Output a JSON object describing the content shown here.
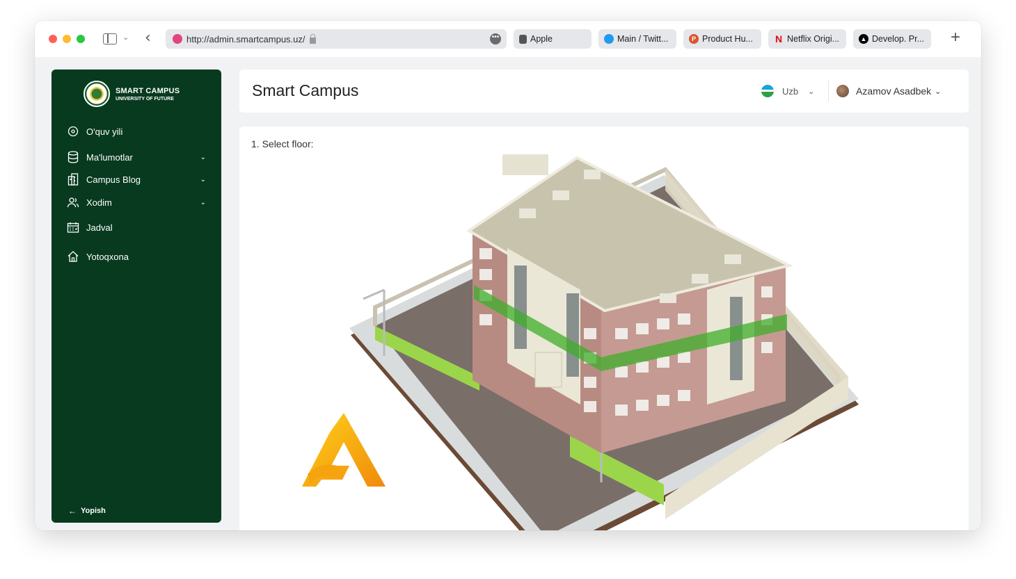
{
  "browser": {
    "url": "http://admin.smartcampus.uz/",
    "tabs": [
      {
        "label": "Apple",
        "icon": "apple-icon",
        "color": "#555555"
      },
      {
        "label": "Main / Twitt...",
        "icon": "twitter-icon",
        "color": "#1d9bf0"
      },
      {
        "label": "Product Hu...",
        "icon": "producthunt-icon",
        "color": "#da552f"
      },
      {
        "label": "Netflix Origi...",
        "icon": "netflix-icon",
        "color": "#e50914"
      },
      {
        "label": "Develop. Pr...",
        "icon": "triangle-icon",
        "color": "#000000"
      }
    ]
  },
  "sidebar": {
    "brand_title": "SMART CAMPUS",
    "brand_subtitle": "UNIVERSITY OF FUTURE",
    "items": [
      {
        "label": "O'quv yili",
        "icon": "disc-icon",
        "has_chevron": false
      },
      {
        "label": "Ma'lumotlar",
        "icon": "database-icon",
        "has_chevron": true
      },
      {
        "label": "Campus Blog",
        "icon": "building-icon",
        "has_chevron": true
      },
      {
        "label": "Xodim",
        "icon": "users-icon",
        "has_chevron": true
      },
      {
        "label": "Jadval",
        "icon": "calendar-icon",
        "has_chevron": false
      },
      {
        "label": "Yotoqxona",
        "icon": "home-icon",
        "has_chevron": false
      }
    ],
    "collapse_label": "Yopish",
    "bg_color": "#073a1f"
  },
  "header": {
    "title": "Smart Campus",
    "language": "Uzb",
    "user_name": "Azamov Asadbek"
  },
  "main": {
    "select_label": "1. Select floor:",
    "highlight_color": "#3fae2a"
  }
}
